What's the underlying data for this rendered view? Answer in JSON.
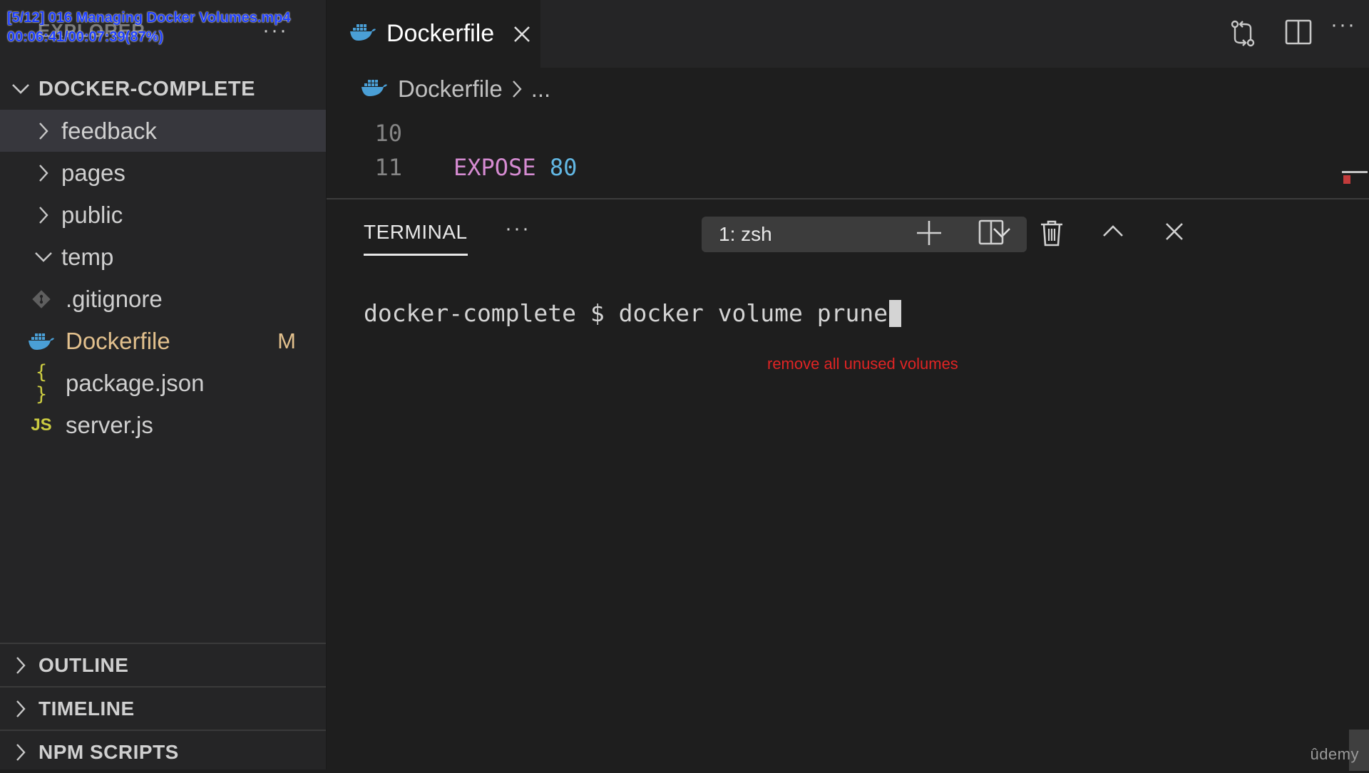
{
  "overlay": {
    "line1": "[5/12] 016 Managing Docker Volumes.mp4",
    "line2": "00:06:41/00:07:39(87%)"
  },
  "sidebar": {
    "title": "EXPLORER",
    "project": "DOCKER-COMPLETE",
    "items": [
      {
        "label": "feedback",
        "type": "folder",
        "expanded": false,
        "selected": true
      },
      {
        "label": "pages",
        "type": "folder",
        "expanded": false
      },
      {
        "label": "public",
        "type": "folder",
        "expanded": false
      },
      {
        "label": "temp",
        "type": "folder",
        "expanded": true
      },
      {
        "label": ".gitignore",
        "type": "file",
        "icon": "git-icon"
      },
      {
        "label": "Dockerfile",
        "type": "file",
        "icon": "docker-icon",
        "badge": "M"
      },
      {
        "label": "package.json",
        "type": "file",
        "icon": "json-icon",
        "icon_text": "{ }"
      },
      {
        "label": "server.js",
        "type": "file",
        "icon": "js-icon",
        "icon_text": "JS"
      }
    ],
    "sections": [
      "OUTLINE",
      "TIMELINE",
      "NPM SCRIPTS"
    ]
  },
  "editor": {
    "tab_label": "Dockerfile",
    "breadcrumb": {
      "file": "Dockerfile",
      "more": "..."
    },
    "lines": [
      {
        "number": "10",
        "keyword": "",
        "value": ""
      },
      {
        "number": "11",
        "keyword": "EXPOSE",
        "value": "80"
      }
    ]
  },
  "panel": {
    "tab": "TERMINAL",
    "terminal_select": "1: zsh",
    "prompt": "docker-complete $ docker volume prune",
    "annotation": "remove all unused volumes"
  },
  "watermark": "ûdemy",
  "colors": {
    "background": "#1e1e1e",
    "sidebar": "#252526",
    "modified": "#e2c08d",
    "keyword": "#d58bd1",
    "number": "#62b7e3",
    "docker_blue": "#4a9fd6",
    "json_yellow": "#cbcb41",
    "annotation_red": "#e02424"
  }
}
